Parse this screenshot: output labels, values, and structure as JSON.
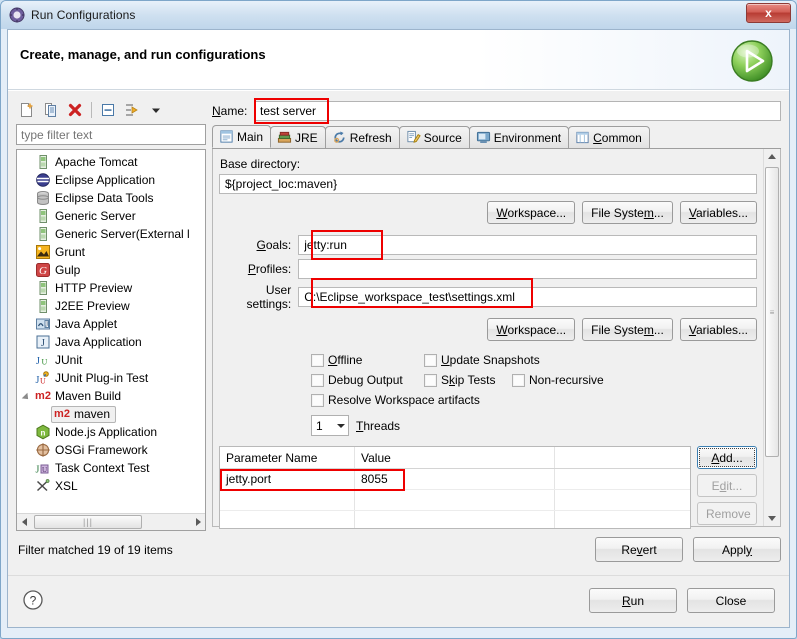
{
  "window": {
    "title": "Run Configurations",
    "title_icon": "run-config-icon",
    "close_label": "x"
  },
  "banner": {
    "title": "Create, manage, and run configurations",
    "icon": "green-run-play-icon"
  },
  "tree_toolbar": {
    "buttons": [
      {
        "name": "new-configuration-icon",
        "label": "New"
      },
      {
        "name": "duplicate-configuration-icon",
        "label": "Duplicate"
      },
      {
        "name": "delete-configuration-icon",
        "label": "Delete"
      },
      {
        "name": "collapse-all-icon",
        "label": "Collapse All"
      },
      {
        "name": "filter-icon",
        "label": "Filter"
      },
      {
        "name": "chevron-down-icon",
        "label": "Menu"
      }
    ]
  },
  "filter": {
    "placeholder": "type filter text",
    "value": "",
    "status": "Filter matched 19 of 19 items"
  },
  "tree": {
    "items": [
      {
        "label": "Apache Tomcat",
        "icon": "server-icon",
        "level": 0
      },
      {
        "label": "Eclipse Application",
        "icon": "eclipse-icon",
        "level": 0
      },
      {
        "label": "Eclipse Data Tools",
        "icon": "database-icon",
        "level": 0
      },
      {
        "label": "Generic Server",
        "icon": "server-icon",
        "level": 0
      },
      {
        "label": "Generic Server(External l",
        "icon": "server-icon",
        "level": 0
      },
      {
        "label": "Grunt",
        "icon": "grunt-icon",
        "level": 0
      },
      {
        "label": "Gulp",
        "icon": "gulp-icon",
        "level": 0
      },
      {
        "label": "HTTP Preview",
        "icon": "server-icon",
        "level": 0
      },
      {
        "label": "J2EE Preview",
        "icon": "server-icon",
        "level": 0
      },
      {
        "label": "Java Applet",
        "icon": "java-applet-icon",
        "level": 0
      },
      {
        "label": "Java Application",
        "icon": "java-application-icon",
        "level": 0
      },
      {
        "label": "JUnit",
        "icon": "junit-icon",
        "level": 0
      },
      {
        "label": "JUnit Plug-in Test",
        "icon": "junit-plugin-icon",
        "level": 0
      },
      {
        "label": "Maven Build",
        "icon": "maven-icon",
        "level": 0,
        "expanded": true
      },
      {
        "label": "maven",
        "icon": "maven-icon",
        "level": 1,
        "selected": true
      },
      {
        "label": "Node.js Application",
        "icon": "nodejs-icon",
        "level": 0
      },
      {
        "label": "OSGi Framework",
        "icon": "osgi-icon",
        "level": 0
      },
      {
        "label": "Task Context Test",
        "icon": "task-context-icon",
        "level": 0
      },
      {
        "label": "XSL",
        "icon": "xsl-icon",
        "level": 0
      }
    ]
  },
  "config": {
    "name_label": "Name:",
    "name_value": "test server",
    "tabs": [
      {
        "label": "Main",
        "icon": "main-tab-icon",
        "active": true
      },
      {
        "label": "JRE",
        "icon": "jre-tab-icon",
        "active": false
      },
      {
        "label": "Refresh",
        "icon": "refresh-tab-icon",
        "active": false
      },
      {
        "label": "Source",
        "icon": "source-tab-icon",
        "active": false
      },
      {
        "label": "Environment",
        "icon": "environment-tab-icon",
        "active": false
      },
      {
        "label": "Common",
        "icon": "common-tab-icon",
        "active": false
      }
    ],
    "base_directory_label": "Base directory:",
    "base_directory_value": "${project_loc:maven}",
    "dir_buttons": [
      "Workspace...",
      "File System...",
      "Variables..."
    ],
    "goals_label": "Goals:",
    "goals_value": "jetty:run",
    "profiles_label": "Profiles:",
    "profiles_value": "",
    "user_settings_label": "User settings:",
    "user_settings_value": "C:\\Eclipse_workspace_test\\settings.xml",
    "settings_buttons": [
      "Workspace...",
      "File System...",
      "Variables..."
    ],
    "checkboxes": [
      {
        "label": "Offline",
        "checked": false
      },
      {
        "label": "Update Snapshots",
        "checked": false
      },
      {
        "label": "Debug Output",
        "checked": false
      },
      {
        "label": "Skip Tests",
        "checked": false
      },
      {
        "label": "Non-recursive",
        "checked": false
      },
      {
        "label": "Resolve Workspace artifacts",
        "checked": false
      }
    ],
    "threads_value": "1",
    "threads_label": "Threads",
    "table": {
      "columns": [
        "Parameter Name",
        "Value",
        ""
      ],
      "rows": [
        {
          "name": "jetty.port",
          "value": "8055",
          "highlighted": true
        },
        {
          "name": "",
          "value": ""
        },
        {
          "name": "",
          "value": ""
        }
      ]
    },
    "table_buttons": [
      {
        "label": "Add...",
        "enabled": true,
        "focused": true
      },
      {
        "label": "Edit...",
        "enabled": false
      },
      {
        "label": "Remove",
        "enabled": false
      }
    ],
    "revert_label": "Revert",
    "apply_label": "Apply"
  },
  "footer": {
    "help_icon": "help-question-icon",
    "run_label": "Run",
    "close_label": "Close"
  },
  "colors": {
    "highlight_red": "#ee0000",
    "accent_blue": "#3c7fb1",
    "panel_bg": "#f0f0f0",
    "maven_red": "#cc2222",
    "green_run": "#5fb331"
  }
}
